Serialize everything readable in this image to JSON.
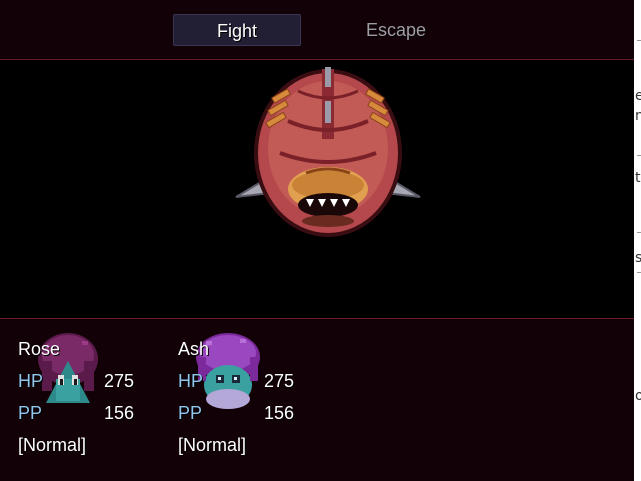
{
  "commands": {
    "fight_label": "Fight",
    "escape_label": "Escape",
    "selected": "Fight"
  },
  "enemy": {
    "icon": "armored-beetle-enemy-icon"
  },
  "party": [
    {
      "name": "Rose",
      "hp_label": "HP",
      "hp": "275",
      "pp_label": "PP",
      "pp": "156",
      "status": "[Normal]",
      "icon": "rose-portrait-icon"
    },
    {
      "name": "Ash",
      "hp_label": "HP",
      "hp": "275",
      "pp_label": "PP",
      "pp": "156",
      "status": "[Normal]",
      "icon": "ash-portrait-icon"
    }
  ],
  "colors": {
    "window_bg": "#120208",
    "border": "#6a1c26",
    "stat_label": "#8fc6ea",
    "selected_cmd_bg": "#221e33",
    "disabled_text": "#a09ca4"
  }
}
